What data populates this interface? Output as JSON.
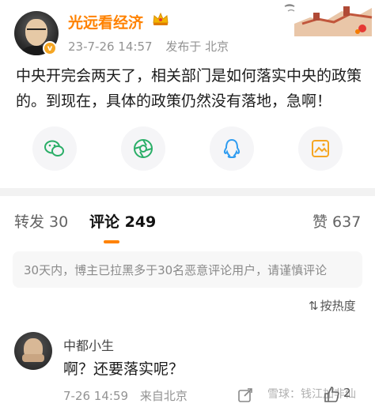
{
  "header": {
    "username": "光远看经济",
    "crown_icon": "crown-icon",
    "verified_badge": "v",
    "timestamp": "23-7-26 14:57",
    "source": "发布于 北京"
  },
  "post": {
    "text": "中央开完会两天了，相关部门是如何落实中央的政策的。到现在，具体的政策仍然没有落地，急啊！"
  },
  "share": {
    "items": [
      "wechat-icon",
      "moments-icon",
      "qq-icon",
      "save-image-icon"
    ]
  },
  "tabs": {
    "repost": "转发 30",
    "comments": "评论 249",
    "likes": "赞 637"
  },
  "notice": "30天内，博主已拉黑多于30名恶意评论用户，请谨慎评论",
  "sort": {
    "label": "按热度",
    "icon": "sort-icon"
  },
  "comment": {
    "name": "中都小生",
    "text": "啊？还要落实呢？",
    "time": "7-26 14:59",
    "source": "来自北京",
    "like_count": "2",
    "watermark": "雪球：钱江加非仙"
  },
  "colors": {
    "accent": "#ff8200",
    "muted": "#939393"
  }
}
